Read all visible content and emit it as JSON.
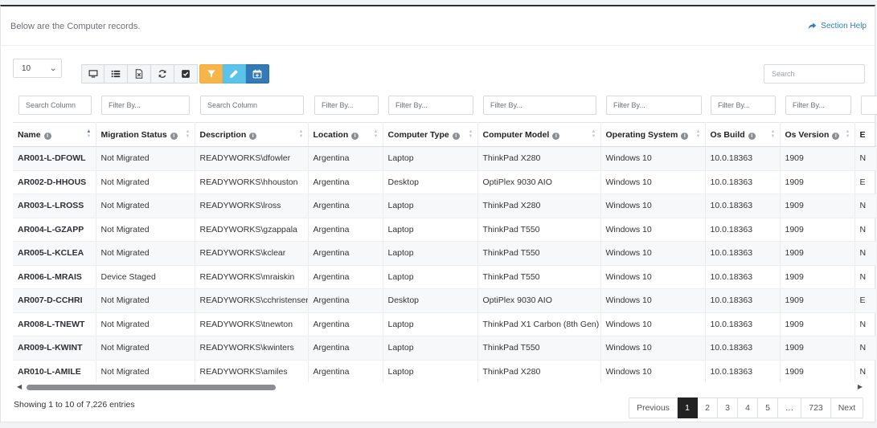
{
  "header": {
    "intro": "Below are the Computer records.",
    "help_label": "Section Help"
  },
  "controls": {
    "page_size": "10",
    "search_placeholder": "Search",
    "toolbar": [
      "monitor-icon",
      "list-icon",
      "excel-export-icon",
      "refresh-icon",
      "check-square-icon",
      "filter-icon",
      "pencil-icon",
      "calendar-plus-icon"
    ]
  },
  "filters": [
    "Search Column",
    "Filter By...",
    "Search Column",
    "Filter By...",
    "Filter By...",
    "Filter By...",
    "Filter By...",
    "Filter By...",
    "Filter By..."
  ],
  "columns": [
    "Name",
    "Migration Status",
    "Description",
    "Location",
    "Computer Type",
    "Computer Model",
    "Operating System",
    "Os Build",
    "Os Version",
    "E"
  ],
  "rows": [
    [
      "AR001-L-DFOWL",
      "Not Migrated",
      "READYWORKS\\dfowler",
      "Argentina",
      "Laptop",
      "ThinkPad X280",
      "Windows 10",
      "10.0.18363",
      "1909",
      "N"
    ],
    [
      "AR002-D-HHOUS",
      "Not Migrated",
      "READYWORKS\\hhouston",
      "Argentina",
      "Desktop",
      "OptiPlex 9030 AIO",
      "Windows 10",
      "10.0.18363",
      "1909",
      "E"
    ],
    [
      "AR003-L-LROSS",
      "Not Migrated",
      "READYWORKS\\lross",
      "Argentina",
      "Laptop",
      "ThinkPad X280",
      "Windows 10",
      "10.0.18363",
      "1909",
      "N"
    ],
    [
      "AR004-L-GZAPP",
      "Not Migrated",
      "READYWORKS\\gzappala",
      "Argentina",
      "Laptop",
      "ThinkPad T550",
      "Windows 10",
      "10.0.18363",
      "1909",
      "N"
    ],
    [
      "AR005-L-KCLEA",
      "Not Migrated",
      "READYWORKS\\kclear",
      "Argentina",
      "Laptop",
      "ThinkPad T550",
      "Windows 10",
      "10.0.18363",
      "1909",
      "N"
    ],
    [
      "AR006-L-MRAIS",
      "Device Staged",
      "READYWORKS\\mraiskin",
      "Argentina",
      "Laptop",
      "ThinkPad T550",
      "Windows 10",
      "10.0.18363",
      "1909",
      "N"
    ],
    [
      "AR007-D-CCHRI",
      "Not Migrated",
      "READYWORKS\\cchristensen",
      "Argentina",
      "Desktop",
      "OptiPlex 9030 AIO",
      "Windows 10",
      "10.0.18363",
      "1909",
      "E"
    ],
    [
      "AR008-L-TNEWT",
      "Not Migrated",
      "READYWORKS\\tnewton",
      "Argentina",
      "Laptop",
      "ThinkPad X1 Carbon (8th Gen)",
      "Windows 10",
      "10.0.18363",
      "1909",
      "N"
    ],
    [
      "AR009-L-KWINT",
      "Not Migrated",
      "READYWORKS\\kwinters",
      "Argentina",
      "Laptop",
      "ThinkPad T550",
      "Windows 10",
      "10.0.18363",
      "1909",
      "N"
    ],
    [
      "AR010-L-AMILE",
      "Not Migrated",
      "READYWORKS\\amiles",
      "Argentina",
      "Laptop",
      "ThinkPad X280",
      "Windows 10",
      "10.0.18363",
      "1909",
      "N"
    ]
  ],
  "footer": {
    "showing": "Showing 1 to 10 of 7,226 entries",
    "pages": [
      "Previous",
      "1",
      "2",
      "3",
      "4",
      "5",
      "…",
      "723",
      "Next"
    ],
    "active_page": "1"
  }
}
